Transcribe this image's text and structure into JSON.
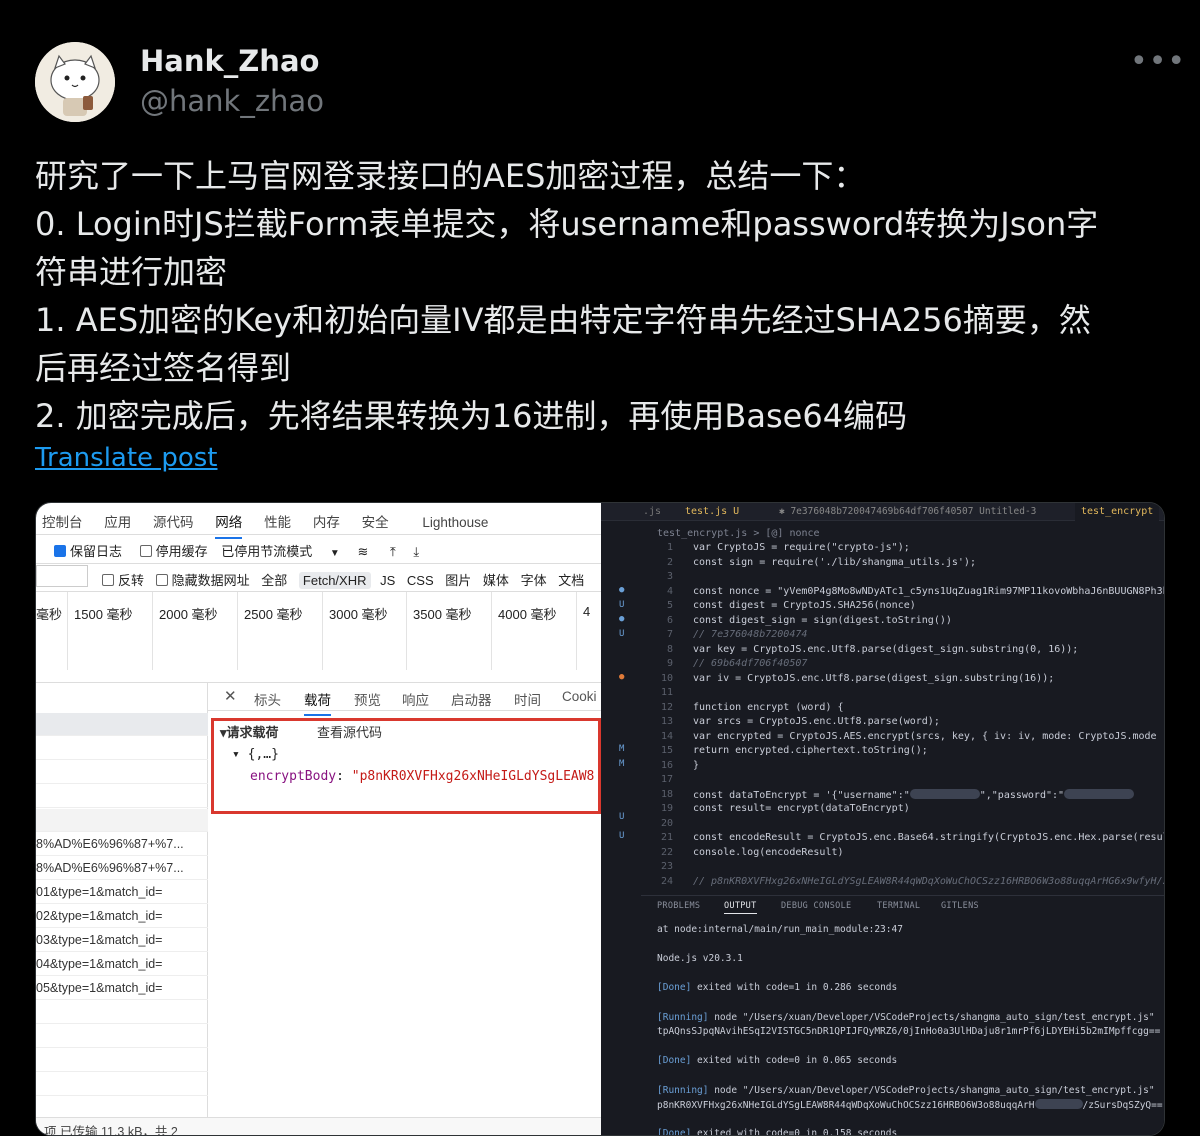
{
  "author": {
    "display_name": "Hank_Zhao",
    "handle": "@hank_zhao",
    "more": "•••"
  },
  "post": {
    "lines": [
      "研究了一下上马官网登录接口的AES加密过程，总结一下：",
      "0. Login时JS拦截Form表单提交，将username和password转换为Json字",
      "符串进行加密",
      "1. AES加密的Key和初始向量IV都是由特定字符串先经过SHA256摘要，然",
      "后再经过签名得到",
      "2. 加密完成后，先将结果转换为16进制，再使用Base64编码"
    ],
    "translate_label": "Translate post"
  },
  "devtools": {
    "tabs": [
      "控制台",
      "应用",
      "源代码",
      "网络",
      "性能",
      "内存",
      "安全",
      "Lighthouse"
    ],
    "active_tab": "网络",
    "toolbar": {
      "preserve_log": "保留日志",
      "disable_cache": "停用缓存",
      "throttle": "已停用节流模式"
    },
    "filters": {
      "invert": "反转",
      "hide_data": "隐藏数据网址",
      "all": "全部",
      "types": [
        "Fetch/XHR",
        "JS",
        "CSS",
        "图片",
        "媒体",
        "字体",
        "文档"
      ]
    },
    "timeline": [
      "毫秒",
      "1500 毫秒",
      "2000 毫秒",
      "2500 毫秒",
      "3000 毫秒",
      "3500 毫秒",
      "4000 毫秒",
      "4"
    ],
    "detail_tabs": [
      "标头",
      "载荷",
      "预览",
      "响应",
      "启动器",
      "时间",
      "Cooki"
    ],
    "payload": {
      "section": "▾请求载荷",
      "view_source": "查看源代码",
      "object": "▾ {,…}",
      "key": "encryptBody",
      "value": "\"p8nKR0XVFHxg26xNHeIGLdYSgLEAW8"
    },
    "requests": [
      "8%AD%E6%96%87+%7...",
      "8%AD%E6%96%87+%7...",
      "01&type=1&match_id=",
      "02&type=1&match_id=",
      "03&type=1&match_id=",
      "04&type=1&match_id=",
      "05&type=1&match_id="
    ],
    "status": "项   已传输 11.3 kB，共 2"
  },
  "vscode": {
    "tabs": [
      ".js",
      "test.js  U",
      "✱ 7e376048b720047469b64df706f40507  Untitled-3",
      "test_encrypt"
    ],
    "breadcrumb": "test_encrypt.js > [@] nonce",
    "code": [
      "var CryptoJS = require(\"crypto-js\");",
      "const sign = require('./lib/shangma_utils.js');",
      "",
      "const nonce = \"yVem0P4g8Mo8wNDyATc1_c5yns1UqZuag1Rim97MP11kovoWbhaJ6nBUUGN8Ph3h\"",
      "const digest = CryptoJS.SHA256(nonce)",
      "const digest_sign = sign(digest.toString())",
      "// 7e376048b7200474",
      "var key = CryptoJS.enc.Utf8.parse(digest_sign.substring(0, 16));",
      "// 69b64df706f40507",
      "var iv  = CryptoJS.enc.Utf8.parse(digest_sign.substring(16));",
      "",
      "function encrypt (word) {",
      "    var srcs = CryptoJS.enc.Utf8.parse(word);",
      "    var encrypted = CryptoJS.AES.encrypt(srcs, key, { iv: iv, mode: CryptoJS.mode",
      "    return encrypted.ciphertext.toString();",
      "}",
      "",
      "const dataToEncrypt = '{\"username\":\"",
      "const result= encrypt(dataToEncrypt)",
      "",
      "const encodeResult = CryptoJS.enc.Base64.stringify(CryptoJS.enc.Hex.parse(result)",
      "console.log(encodeResult)",
      "",
      "// p8nKR0XVFHxg26xNHeIGLdYSgLEAW8R44qWDqXoWuChOCSzz16HRBO6W3o88uqqArHG6x9wfyH/zSu"
    ],
    "password_label": "\",\"password\":\"",
    "panel_tabs": [
      "PROBLEMS",
      "OUTPUT",
      "DEBUG CONSOLE",
      "TERMINAL",
      "GITLENS"
    ],
    "output": [
      "    at node:internal/main/run_main_module:23:47",
      "",
      "Node.js v20.3.1",
      "",
      "[Done] exited with code=1 in 0.286 seconds",
      "",
      "[Running] node \"/Users/xuan/Developer/VSCodeProjects/shangma_auto_sign/test_encrypt.js\"",
      "tpAQnsSJpqNAvihESqI2VISTGC5nDR1QPIJFQyMRZ6/0jInHo0a3UlHDaju8r1mrPf6jLDYEHi5b2mIMpffcgg==",
      "",
      "[Done] exited with code=0 in 0.065 seconds",
      "",
      "[Running] node \"/Users/xuan/Developer/VSCodeProjects/shangma_auto_sign/test_encrypt.js\"",
      "p8nKR0XVFHxg26xNHeIGLdYSgLEAW8R44qWDqXoWuChOCSzz16HRBO6W3o88uqqArH",
      "",
      "[Done] exited with code=0 in 0.158 seconds"
    ],
    "output_tail": "/zSursDqSZyQ=="
  }
}
